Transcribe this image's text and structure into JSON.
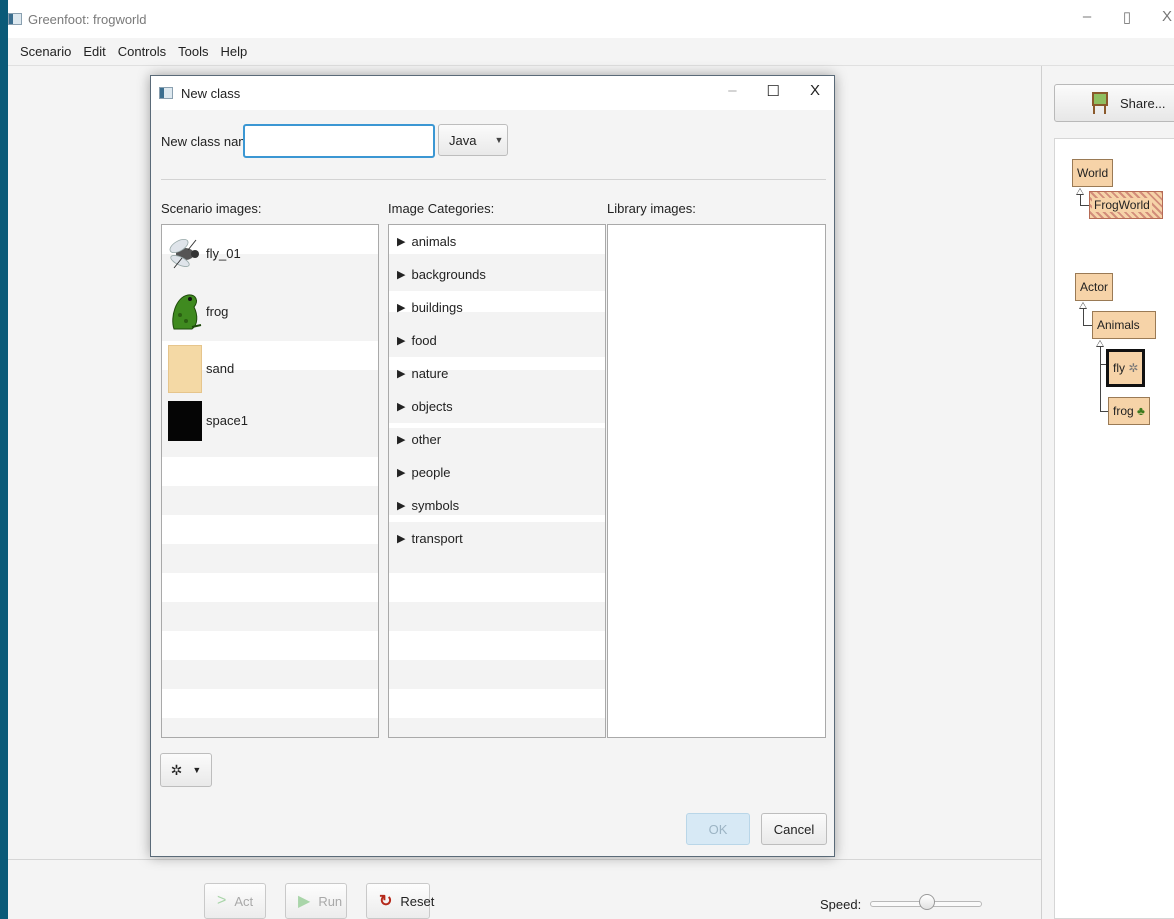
{
  "main_window": {
    "title": "Greenfoot: frogworld",
    "menu": [
      "Scenario",
      "Edit",
      "Controls",
      "Tools",
      "Help"
    ],
    "window_controls": {
      "minimize": "–",
      "restore": "▯",
      "close": "X"
    }
  },
  "class_panel": {
    "share_label": "Share...",
    "classes": {
      "world": "World",
      "frogworld": "FrogWorld",
      "actor": "Actor",
      "animals": "Animals",
      "fly": "fly",
      "frog": "frog"
    },
    "selected": "fly"
  },
  "controls": {
    "act_label": "Act",
    "run_label": "Run",
    "reset_label": "Reset",
    "speed_label": "Speed:",
    "speed_value": 0.55
  },
  "dialog": {
    "title": "New class",
    "window_controls": {
      "minimize": "–",
      "maximize": "☐",
      "close": "X"
    },
    "class_name_label": "New class name:",
    "class_name_value": "",
    "language_selected": "Java",
    "scenario_images_label": "Scenario images:",
    "image_categories_label": "Image Categories:",
    "library_images_label": "Library images:",
    "scenario_images": [
      {
        "name": "fly_01",
        "icon": "fly-icon"
      },
      {
        "name": "frog",
        "icon": "frog-icon"
      },
      {
        "name": "sand",
        "icon": "sand-swatch"
      },
      {
        "name": "space1",
        "icon": "space-swatch"
      }
    ],
    "categories": [
      "animals",
      "backgrounds",
      "buildings",
      "food",
      "nature",
      "objects",
      "other",
      "people",
      "symbols",
      "transport"
    ],
    "library_images": [],
    "ok_label": "OK",
    "cancel_label": "Cancel"
  },
  "colors": {
    "desktop": "#0a5a78",
    "class_box": "#f6d3a8",
    "focus_accent": "#3b97d3",
    "ok_disabled": "#d7e9f5",
    "reset_icon": "#b5291b",
    "play_icon": "#5cb85c"
  }
}
